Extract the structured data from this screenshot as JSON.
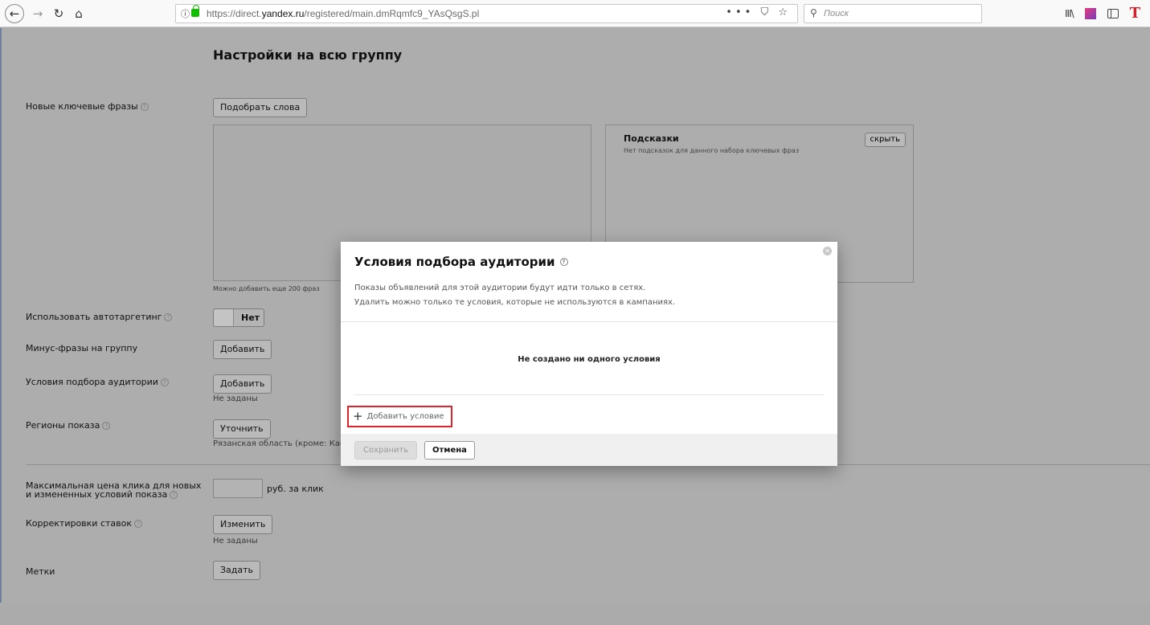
{
  "browser": {
    "url_prefix": "https://direct.",
    "url_domain": "yandex.ru",
    "url_path": "/registered/main.dmRqmfc9_YAsQsgS.pl",
    "search_placeholder": "Поиск"
  },
  "page": {
    "section_title": "Настройки на всю группу",
    "new_keywords_label": "Новые ключевые фразы",
    "pick_words_button": "Подобрать слова",
    "keywords_note": "Можно добавить еще 200 фраз",
    "hints": {
      "title": "Подсказки",
      "subtitle": "Нет подсказок для данного набора ключевых фраз",
      "hide_button": "скрыть"
    },
    "autotargeting_label": "Использовать автотаргетинг",
    "autotargeting_value": "Нет",
    "minus_phrases_label": "Минус-фразы на группу",
    "minus_phrases_button": "Добавить",
    "audience_label": "Условия подбора аудитории",
    "audience_button": "Добавить",
    "audience_note": "Не заданы",
    "regions_label": "Регионы показа",
    "regions_button": "Уточнить",
    "regions_note": "Рязанская область (кроме: Касим",
    "max_price_label_line1": "Максимальная цена клика для новых",
    "max_price_label_line2": "и измененных условий показа",
    "price_unit": "руб. за клик",
    "bid_adjust_label": "Корректировки ставок",
    "bid_adjust_button": "Изменить",
    "bid_adjust_note": "Не заданы",
    "tags_label": "Метки",
    "tags_button": "Задать"
  },
  "modal": {
    "title": "Условия подбора аудитории",
    "description_line1": "Показы объявлений для этой аудитории будут идти только в сетях.",
    "description_line2": "Удалить можно только те условия, которые не используются в кампаниях.",
    "empty_text": "Не создано ни одного условия",
    "add_condition": "Добавить условие",
    "save_button": "Сохранить",
    "cancel_button": "Отмена"
  },
  "colors": {
    "highlight": "#e0242e",
    "lock": "#12bc00"
  }
}
